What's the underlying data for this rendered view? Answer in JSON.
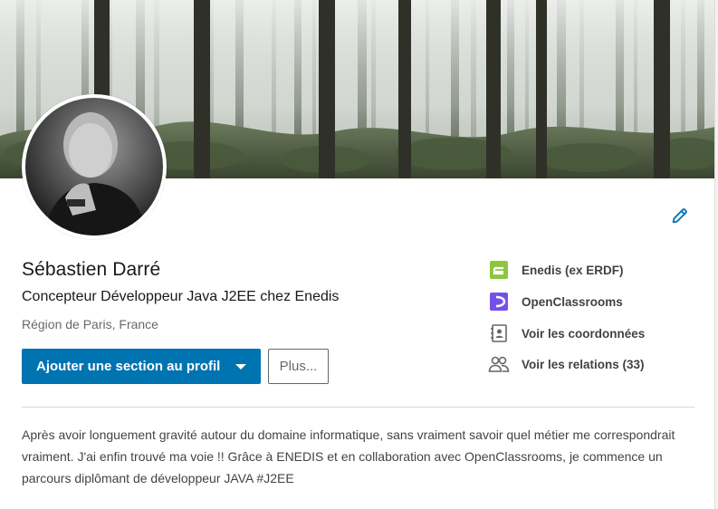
{
  "profile": {
    "name": "Sébastien Darré",
    "headline": "Concepteur Développeur Java J2EE chez Enedis",
    "location": "Région de Paris, France"
  },
  "actions": {
    "primary_label": "Ajouter une section au profil",
    "more_label": "Plus..."
  },
  "side": {
    "company": "Enedis (ex ERDF)",
    "school": "OpenClassrooms",
    "contact": "Voir les coordonnées",
    "connections": "Voir les relations (33)"
  },
  "summary": "Après avoir longuement gravité autour du domaine informatique, sans vraiment savoir quel métier me correspondrait vraiment. J'ai enfin trouvé ma voie !! Grâce à ENEDIS et en collaboration avec OpenClassrooms, je commence un parcours diplômant de développeur JAVA #J2EE",
  "icons": {
    "edit": "pencil-icon",
    "company_logo": "enedis-logo-icon",
    "school_logo": "openclassrooms-logo-icon",
    "contact": "contact-card-icon",
    "connections": "people-icon",
    "dropdown": "caret-down-icon"
  },
  "colors": {
    "accent": "#0073b1",
    "enedis_green": "#8cc63f",
    "openclassrooms_purple": "#7451eb"
  }
}
